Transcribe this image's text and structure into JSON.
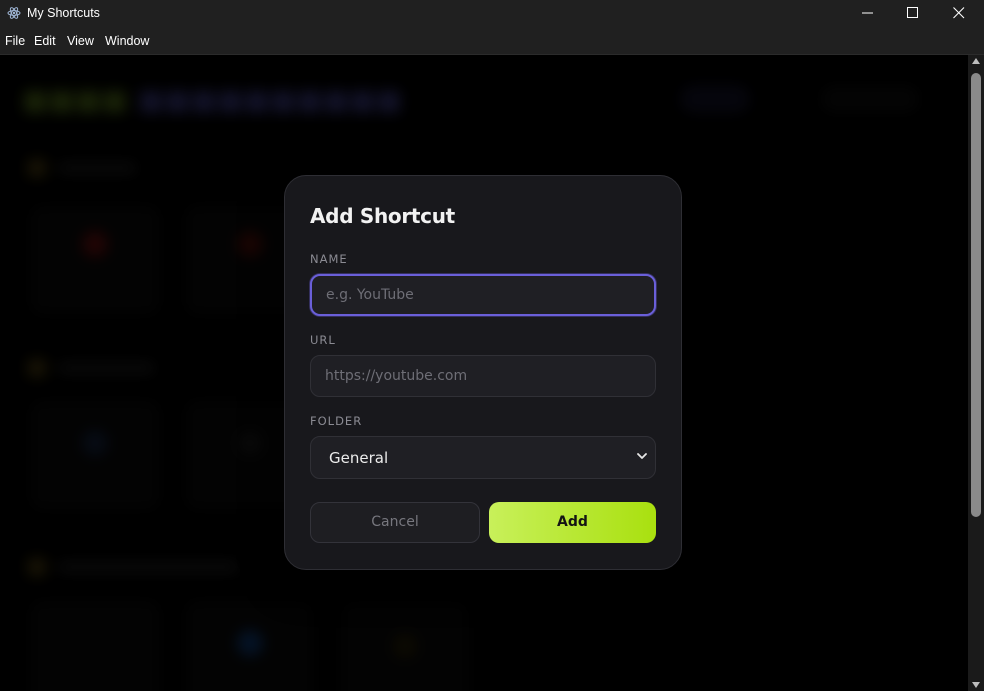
{
  "window": {
    "title": "My Shortcuts",
    "icon": "electron-app-icon"
  },
  "window_controls": {
    "minimize_icon": "minimize-icon",
    "maximize_icon": "maximize-icon",
    "close_icon": "close-icon"
  },
  "menu": {
    "items": [
      "File",
      "Edit",
      "View",
      "Window"
    ]
  },
  "modal": {
    "title": "Add Shortcut",
    "name_label": "NAME",
    "name_placeholder": "e.g. YouTube",
    "name_value": "",
    "url_label": "URL",
    "url_placeholder": "https://youtube.com",
    "url_value": "",
    "folder_label": "FOLDER",
    "folder_value": "General",
    "cancel_label": "Cancel",
    "add_label": "Add"
  },
  "colors": {
    "accent_focus": "#6a5fd9",
    "add_button": "#b4e62c",
    "modal_bg": "#18181c"
  }
}
